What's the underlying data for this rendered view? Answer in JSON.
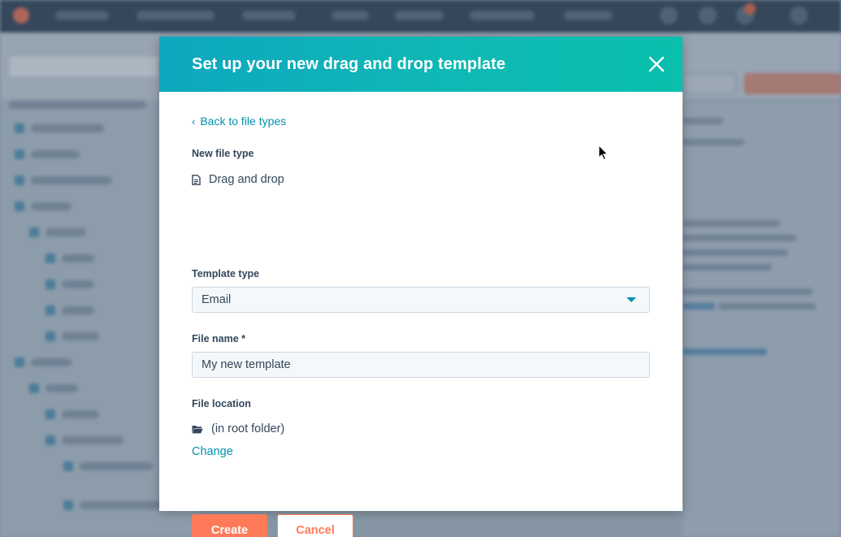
{
  "modal": {
    "title": "Set up your new drag and drop template",
    "back_link_label": "Back to file types",
    "new_file_type": {
      "label": "New file type",
      "value": "Drag and drop",
      "icon": "document-icon"
    },
    "template_type": {
      "label": "Template type",
      "selected": "Email"
    },
    "file_name": {
      "label": "File name *",
      "value": "My new template"
    },
    "file_location": {
      "label": "File location",
      "value": "(in root folder)",
      "icon": "folder-open-icon",
      "change_label": "Change"
    },
    "buttons": {
      "create_label": "Create",
      "cancel_label": "Cancel"
    }
  },
  "colors": {
    "header_gradient_start": "#0ea7bf",
    "header_gradient_end": "#09bfae",
    "link": "#0091ae",
    "primary_button": "#ff7a59",
    "text": "#33475b",
    "input_bg": "#f5f8fa",
    "input_border": "#cbd6e2"
  }
}
